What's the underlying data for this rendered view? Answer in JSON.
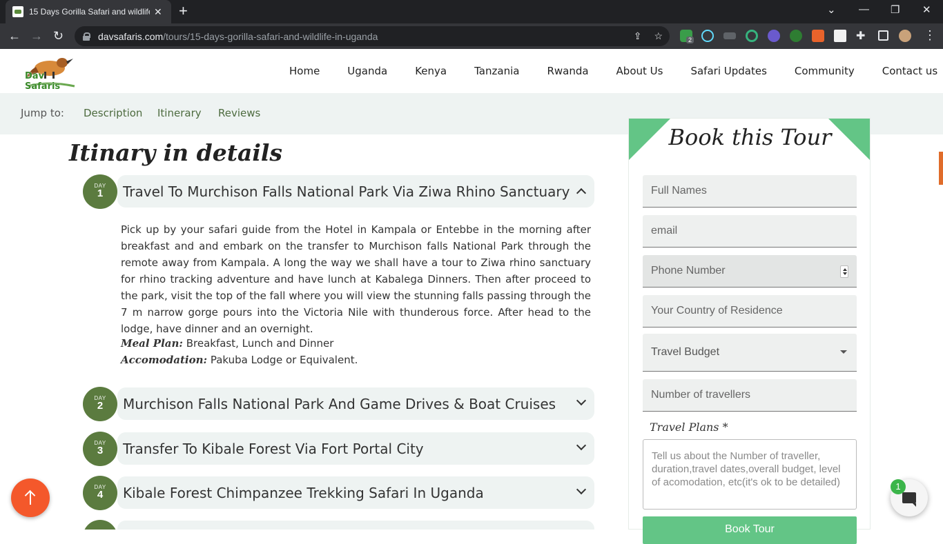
{
  "browser": {
    "tab_title": "15 Days Gorilla Safari and wildlife in Uganda",
    "tab_close": "✕",
    "new_tab": "+",
    "url_host": "davsafaris.com",
    "url_path": "/tours/15-days-gorilla-safari-and-wildlife-in-uganda",
    "extension_badge": "2",
    "window_controls": [
      "⌄",
      "—",
      "❐",
      "✕"
    ]
  },
  "site": {
    "logo_text": "Dav Safaris",
    "nav": [
      "Home",
      "Uganda",
      "Kenya",
      "Tanzania",
      "Rwanda",
      "About Us",
      "Safari Updates",
      "Community",
      "Contact us"
    ]
  },
  "jump": {
    "label": "Jump to:",
    "links": [
      "Description",
      "Itinerary",
      "Reviews"
    ]
  },
  "itinerary": {
    "heading": "Itinary in details",
    "day_label": "DAY",
    "days": [
      {
        "num": "1",
        "title": "Travel To Murchison Falls National Park Via Ziwa Rhino Sanctuary",
        "expanded": true
      },
      {
        "num": "2",
        "title": "Murchison Falls National Park And Game Drives & Boat Cruises",
        "expanded": false
      },
      {
        "num": "3",
        "title": "Transfer To Kibale Forest Via Fort Portal City",
        "expanded": false
      },
      {
        "num": "4",
        "title": "Kibale Forest Chimpanzee Trekking Safari In Uganda",
        "expanded": false
      }
    ],
    "day1_description": "Pick up by your safari guide from the Hotel in Kampala or Entebbe in the morning after breakfast and and embark on the transfer to Murchison falls National Park through the remote away from Kampala. A long the way we shall have a tour to Ziwa rhino sanctuary for rhino tracking adventure and have lunch at Kabalega Dinners. Then after proceed to the park, visit the top of the fall where you will view the stunning falls passing through the 7 m narrow gorge pours into the Victoria Nile with thunderous force. After head to the lodge, have dinner and an overnight.",
    "meal_label": "Meal Plan:",
    "meal_value": "Breakfast, Lunch and Dinner",
    "accom_label": "Accomodation:",
    "accom_value": "Pakuba Lodge or Equivalent."
  },
  "booking": {
    "title": "Book this Tour",
    "full_names_placeholder": "Full Names",
    "email_placeholder": "email",
    "phone_placeholder": "Phone Number",
    "country_placeholder": "Your Country of Residence",
    "budget_label": "Travel Budget",
    "travellers_placeholder": "Number of travellers",
    "plans_label": "Travel Plans *",
    "plans_placeholder": "Tell us about the Number of traveller, duration,travel dates,overall budget, level of acomodation, etc(it's ok to be detailed)",
    "button_label": "Book Tour"
  },
  "chat": {
    "badge_count": "1"
  },
  "colors": {
    "accent_green": "#63c586",
    "day_green": "#5b7b3f",
    "fab_orange": "#f4582b"
  }
}
